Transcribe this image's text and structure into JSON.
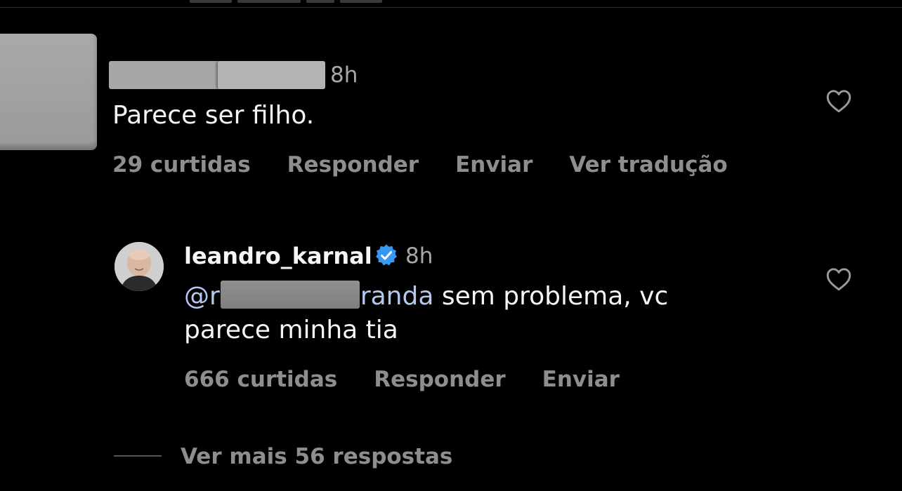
{
  "comment": {
    "time": "8h",
    "text": "Parece ser filho.",
    "actions": {
      "likes": "29 curtidas",
      "reply": "Responder",
      "send": "Enviar",
      "translate": "Ver tradução"
    },
    "like_icon": "heart-outline-icon"
  },
  "reply": {
    "username": "leandro_karnal",
    "verified_icon": "verified-badge-icon",
    "verified_color": "#3897f0",
    "time": "8h",
    "mention_prefix": "@r",
    "mention_suffix": "randa",
    "text_line1": " sem problema, vc",
    "text_line2": "parece minha tia",
    "actions": {
      "likes": "666 curtidas",
      "reply": "Responder",
      "send": "Enviar"
    },
    "like_icon": "heart-outline-icon"
  },
  "view_more": "Ver mais 56 respostas",
  "colors": {
    "background": "#000000",
    "text": "#f5f5f5",
    "secondary": "#8e8e8e",
    "mention": "#b5c9ef"
  }
}
